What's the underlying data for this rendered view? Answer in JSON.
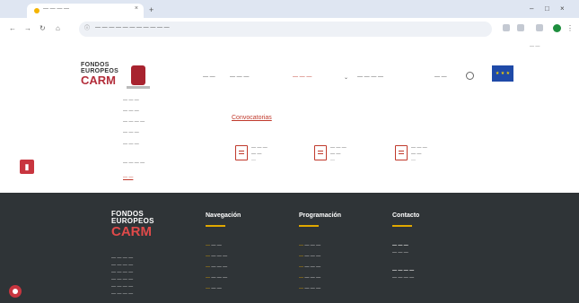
{
  "browser": {
    "tab_title": "— — — —",
    "tab_close": "×",
    "new_tab": "+",
    "url": "— — — — — — — — — — —",
    "window_controls": [
      "–",
      "□",
      "×"
    ],
    "nav_icons": [
      "back-arrow-icon",
      "forward-arrow-icon",
      "reload-icon",
      "home-icon"
    ],
    "bookmarks_label": "— —"
  },
  "site": {
    "logo": {
      "line1": "FONDOS",
      "line2": "EUROPEOS",
      "line3": "CARM"
    },
    "menu": [
      {
        "label": "— —",
        "active": false
      },
      {
        "label": "— — —",
        "active": false
      },
      {
        "label": "— — —",
        "active": true
      },
      {
        "label": "— — — —",
        "active": false
      },
      {
        "label": "— —",
        "active": false
      }
    ],
    "menu_chevron": "⌄",
    "eu_flag_stars": "★ ★ ★"
  },
  "dropdown": {
    "items": [
      {
        "label": "— — —",
        "active": false
      },
      {
        "label": "— — —",
        "active": false
      },
      {
        "label": "— — — —",
        "active": false
      },
      {
        "label": "— — —",
        "active": false
      },
      {
        "label": "— — —",
        "active": false
      },
      {
        "label": "— — — —",
        "active": false
      },
      {
        "label": "— —",
        "active": true
      }
    ]
  },
  "side_bookmark_icon": "bookmark-icon",
  "convocatorias": {
    "title": "Convocatorias",
    "cards": [
      {
        "line1": "— — —",
        "line2": "— —",
        "line3": "—"
      },
      {
        "line1": "— — —",
        "line2": "— —",
        "line3": "—"
      },
      {
        "line1": "— — —",
        "line2": "— —",
        "line3": "—"
      }
    ]
  },
  "footer": {
    "logo": {
      "line1": "FONDOS",
      "line2": "EUROPEOS",
      "line3": "CARM"
    },
    "description_lines": [
      "— — — —",
      "— — — —",
      "— — — —",
      "— — — —",
      "— — — —",
      "— — — —"
    ],
    "navegacion": {
      "title": "Navegación",
      "items": [
        "— —",
        "— — —",
        "— — —",
        "— — —",
        "— —"
      ]
    },
    "programacion": {
      "title": "Programación",
      "items": [
        "— — —",
        "— — —",
        "— — —",
        "— — —",
        "— — —"
      ]
    },
    "contacto": {
      "title": "Contacto",
      "phone_label": "— — —",
      "phone_value": "— — —",
      "email_label": "— — — —",
      "email_value": "— — — —"
    },
    "bullet": "—"
  },
  "colors": {
    "accent": "#c0392b",
    "footer_bg": "#2f3437",
    "footer_bar": "#e0a800",
    "eu_blue": "#1f4aa8"
  }
}
